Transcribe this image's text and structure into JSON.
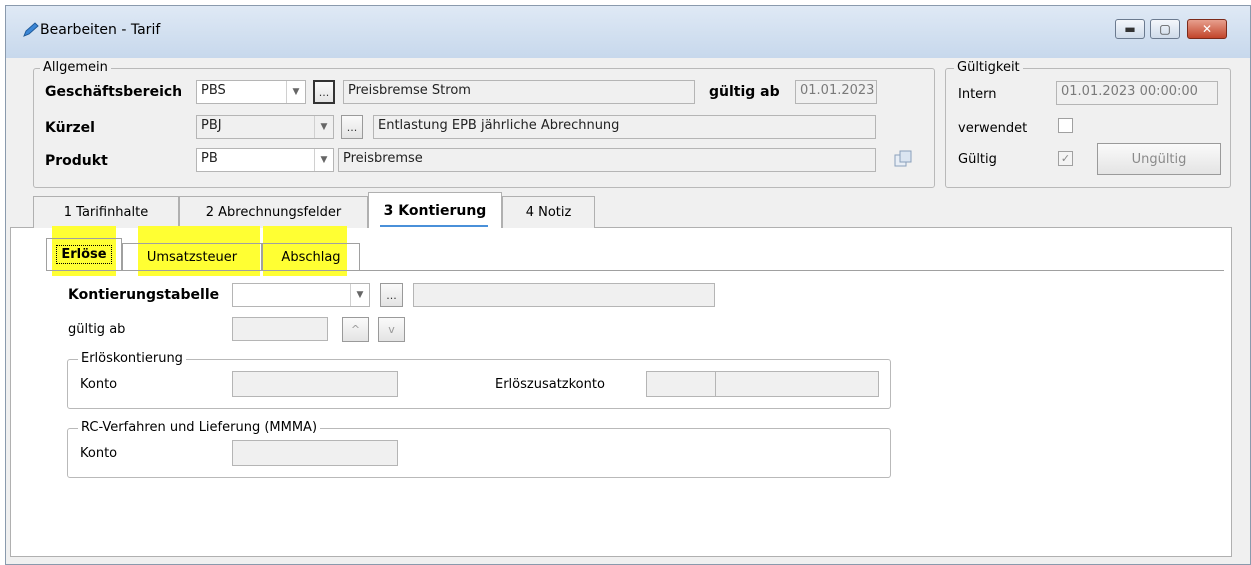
{
  "window": {
    "title": "Bearbeiten - Tarif"
  },
  "allgemein": {
    "group_label": "Allgemein",
    "geschaeftsbereich_label": "Geschäftsbereich",
    "geschaeftsbereich_value": "PBS",
    "geschaeftsbereich_desc": "Preisbremse Strom",
    "gueltig_ab_label": "gültig ab",
    "gueltig_ab_value": "01.01.2023",
    "kuerzel_label": "Kürzel",
    "kuerzel_value": "PBJ",
    "kuerzel_desc": "Entlastung EPB jährliche Abrechnung",
    "produkt_label": "Produkt",
    "produkt_value": "PB",
    "produkt_desc": "Preisbremse",
    "ellipsis": "..."
  },
  "gueltigkeit": {
    "group_label": "Gültigkeit",
    "intern_label": "Intern",
    "intern_value": "01.01.2023 00:00:00",
    "verwendet_label": "verwendet",
    "verwendet_checked": false,
    "gueltig_label": "Gültig",
    "gueltig_checked": true,
    "ungueltig_button": "Ungültig"
  },
  "tabs": [
    {
      "label": "1 Tarifinhalte"
    },
    {
      "label": "2 Abrechnungsfelder"
    },
    {
      "label": "3 Kontierung",
      "active": true
    },
    {
      "label": "4 Notiz"
    }
  ],
  "subtabs": [
    {
      "label": "Erlöse",
      "active": true
    },
    {
      "label": "Umsatzsteuer"
    },
    {
      "label": "Abschlag"
    }
  ],
  "kontierung": {
    "tabelle_label": "Kontierungstabelle",
    "tabelle_value": "",
    "gueltig_ab_label": "gültig ab",
    "up_arrow": "^",
    "down_arrow": "v",
    "erloes_group": "Erlöskontierung",
    "konto_label": "Konto",
    "zusatzkonto_label": "Erlöszusatzkonto",
    "rc_group": "RC-Verfahren und Lieferung (MMMA)",
    "rc_konto_label": "Konto"
  },
  "colors": {
    "highlight": "#ffff33",
    "titlebar": "#c7d8ec"
  }
}
